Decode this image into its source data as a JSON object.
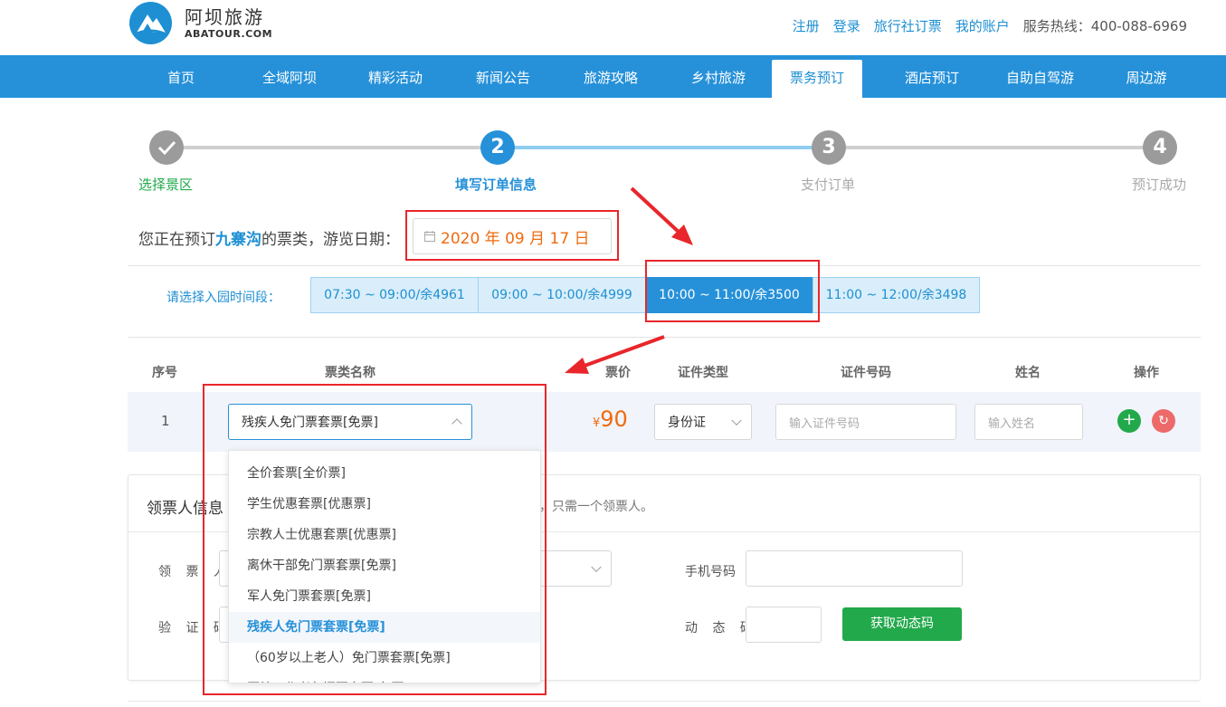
{
  "header": {
    "logo_cn": "阿坝旅游",
    "logo_en": "ABATOUR.COM",
    "links": [
      "注册",
      "登录",
      "旅行社订票",
      "我的账户"
    ],
    "hotline": "服务热线：400-088-6969"
  },
  "nav": {
    "items": [
      "首页",
      "全域阿坝",
      "精彩活动",
      "新闻公告",
      "旅游攻略",
      "乡村旅游",
      "票务预订",
      "酒店预订",
      "自助自驾游",
      "周边游"
    ],
    "active": "票务预订"
  },
  "steps": [
    {
      "num": "",
      "label": "选择景区",
      "state": "done"
    },
    {
      "num": "2",
      "label": "填写订单信息",
      "state": "current"
    },
    {
      "num": "3",
      "label": "支付订单",
      "state": "todo"
    },
    {
      "num": "4",
      "label": "预订成功",
      "state": "todo"
    }
  ],
  "booking": {
    "prefix": "您正在预订",
    "place": "九寨沟",
    "suffix": "的票类，游览日期：",
    "date": "2020 年 09 月 17 日"
  },
  "timeslots": {
    "label": "请选择入园时间段：",
    "items": [
      "07:30 ~ 09:00/余4961",
      "09:00 ~ 10:00/余4999",
      "10:00 ~ 11:00/余3500",
      "11:00 ~ 12:00/余3498"
    ],
    "selected": "10:00 ~ 11:00/余3500"
  },
  "table": {
    "headers": [
      "序号",
      "票类名称",
      "票价",
      "证件类型",
      "证件号码",
      "姓名",
      "操作"
    ],
    "row": {
      "no": "1",
      "ticket_type": "残疾人免门票套票[免票]",
      "price_currency": "¥",
      "price": "90",
      "id_type": "身份证",
      "id_placeholder": "输入证件号码",
      "name_placeholder": "输入姓名",
      "add": "+",
      "reset": "↻"
    }
  },
  "holder": {
    "title": "领票人信息",
    "tip": "，只需一个领票人。",
    "label_holder": "领 票 人",
    "label_phone": "手机号码",
    "label_captcha": "验 证 码",
    "label_dynamic": "动 态 码",
    "btn_get_code": "获取动态码"
  },
  "dropdown": {
    "options": [
      "全价套票[全价票]",
      "学生优惠套票[优惠票]",
      "宗教人士优惠套票[优惠票]",
      "离休干部免门票套票[免票]",
      "军人免门票套票[免票]",
      "残疾人免门票套票[免票]",
      "（60岁以上老人）免门票套票[免票]",
      "医护工作者免门票套票[免票]"
    ],
    "selected": "残疾人免门票套票[免票]"
  },
  "colors": {
    "brand_blue": "#2691d9",
    "accent_orange": "#f06a0f",
    "success_green": "#22a94b",
    "danger_red": "#ec6a6a",
    "annotation_red": "#e8262b"
  }
}
